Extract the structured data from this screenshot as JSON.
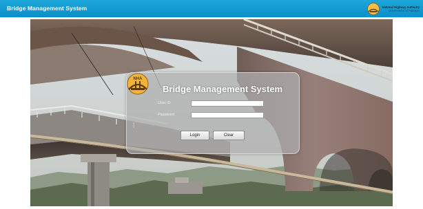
{
  "header": {
    "app_title": "Bridge Management System",
    "authority_name": "National Highway Authority",
    "authority_sub": "Government of Pakistan"
  },
  "login": {
    "title": "Bridge Management System",
    "logo_text": "NHA",
    "user_id_label": "User ID",
    "user_id_value": "",
    "password_label": "Password",
    "password_value": "",
    "login_button": "Login",
    "clear_button": "Clear"
  },
  "colors": {
    "header_bar": "#1ea7da",
    "logo_gold": "#e8a72a",
    "bridge_stone": "#8a6e5e"
  },
  "icons": {
    "header_logo": "nha-emblem-icon",
    "panel_logo": "nha-emblem-icon"
  }
}
